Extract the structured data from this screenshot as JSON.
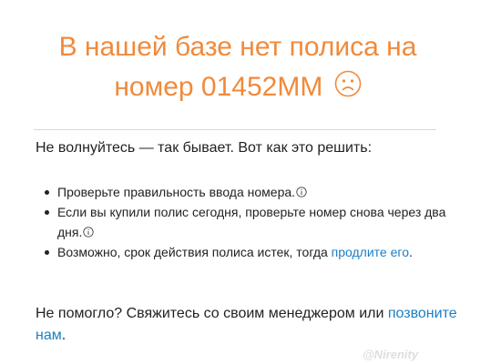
{
  "header": {
    "title_line1": "В нашей базе нет полиса на",
    "title_line2": "номер 01452ММ",
    "face_icon": "sad-face-icon",
    "accent_color": "#f08a3c"
  },
  "intro": {
    "text": "Не волнуйтесь — так бывает. Вот как это решить:"
  },
  "tips": {
    "item1": "Проверьте правильность ввода номера.",
    "item2": "Если вы купили полис сегодня, проверьте номер снова через два дня.",
    "item3_prefix": "Возможно, срок действия полиса истек, тогда",
    "item3_link": "продлите его",
    "item3_suffix": ".",
    "info_icon": "info-icon"
  },
  "outro": {
    "text": "Не помогло? Свяжитесь со своим менеджером или",
    "link": "позвоните нам",
    "suffix": ".",
    "link_color": "#1a7fc4"
  },
  "watermark": {
    "text": "@Nirenity"
  }
}
